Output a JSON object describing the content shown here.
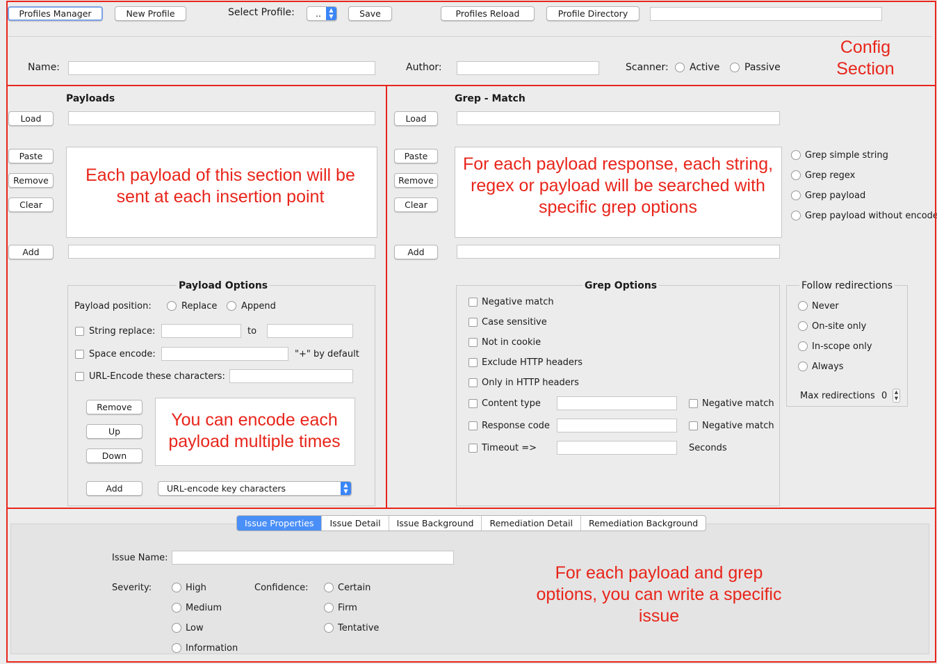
{
  "toolbar": {
    "profiles_manager": "Profiles Manager",
    "new_profile": "New Profile",
    "select_profile_label": "Select Profile:",
    "select_profile_value": "..",
    "save": "Save",
    "profiles_reload": "Profiles Reload",
    "profile_directory": "Profile Directory"
  },
  "config": {
    "name_label": "Name:",
    "author_label": "Author:",
    "scanner_label": "Scanner:",
    "scanner_active": "Active",
    "scanner_passive": "Passive",
    "annotation": "Config\nSection"
  },
  "payloads": {
    "title": "Payloads",
    "load": "Load",
    "paste": "Paste",
    "remove": "Remove",
    "clear": "Clear",
    "add": "Add",
    "annotation": "Each payload of this section will be sent at each insertion point"
  },
  "payload_options": {
    "title": "Payload  Options",
    "position_label": "Payload position:",
    "replace": "Replace",
    "append": "Append",
    "string_replace": "String replace:",
    "to": "to",
    "space_encode": "Space encode:",
    "space_default": "\"+\" by default",
    "url_encode": "URL-Encode these characters:",
    "remove": "Remove",
    "up": "Up",
    "down": "Down",
    "add": "Add",
    "encoder_value": "URL-encode key characters",
    "annotation": "You can encode each payload multiple times"
  },
  "grep": {
    "title": "Grep - Match",
    "load": "Load",
    "paste": "Paste",
    "remove": "Remove",
    "clear": "Clear",
    "add": "Add",
    "annotation": "For each payload response, each string, regex or payload will be searched with specific grep options",
    "type_simple": "Grep simple string",
    "type_regex": "Grep regex",
    "type_payload": "Grep payload",
    "type_payload_noenc": "Grep payload without encode"
  },
  "grep_options": {
    "title": "Grep Options",
    "negative_match": "Negative match",
    "case_sensitive": "Case sensitive",
    "not_in_cookie": "Not in cookie",
    "exclude_headers": "Exclude HTTP headers",
    "only_headers": "Only in HTTP headers",
    "content_type": "Content type",
    "content_type_negative": "Negative match",
    "response_code": "Response code",
    "response_code_negative": "Negative match",
    "timeout": "Timeout =>",
    "seconds": "Seconds"
  },
  "redirections": {
    "title": "Follow redirections",
    "never": "Never",
    "onsite": "On-site only",
    "inscope": "In-scope only",
    "always": "Always",
    "max_label": "Max redirections",
    "max_value": "0"
  },
  "issue": {
    "tabs": [
      "Issue Properties",
      "Issue Detail",
      "Issue Background",
      "Remediation Detail",
      "Remediation Background"
    ],
    "name_label": "Issue Name:",
    "severity_label": "Severity:",
    "sev_high": "High",
    "sev_medium": "Medium",
    "sev_low": "Low",
    "sev_info": "Information",
    "confidence_label": "Confidence:",
    "conf_certain": "Certain",
    "conf_firm": "Firm",
    "conf_tentative": "Tentative",
    "annotation": "For each payload and grep options, you can write a specific issue"
  },
  "colors": {
    "annotation_red": "#e8251b",
    "active_tab": "#4a8ff7",
    "background": "#ececec"
  }
}
